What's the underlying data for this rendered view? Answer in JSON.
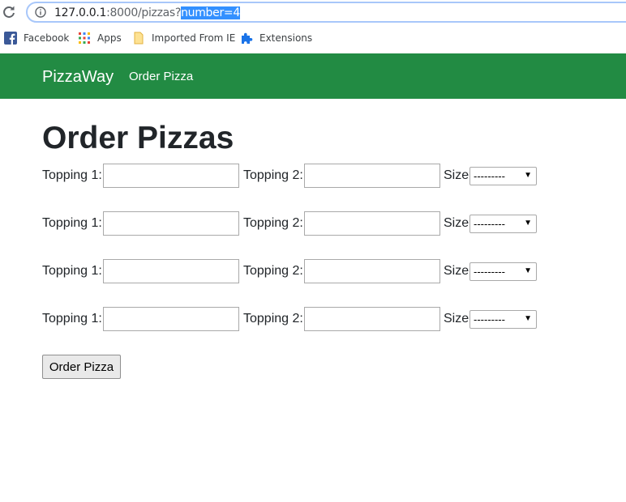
{
  "browser": {
    "url_host": "127.0.0.1",
    "url_path": ":8000/pizzas?",
    "url_selected": "number=4",
    "bookmarks": [
      {
        "label": "Facebook",
        "icon": "facebook-icon"
      },
      {
        "label": "Apps",
        "icon": "apps-grid-icon"
      },
      {
        "label": "Imported From IE",
        "icon": "folder-icon"
      },
      {
        "label": "Extensions",
        "icon": "puzzle-icon"
      }
    ]
  },
  "navbar": {
    "brand": "PizzaWay",
    "link": "Order Pizza",
    "color": "#228b43"
  },
  "main": {
    "title": "Order Pizzas",
    "rows": [
      {
        "topping1_label": "Topping 1:",
        "topping1_value": "",
        "topping2_label": "Topping 2:",
        "topping2_value": "",
        "size_label": "Size:",
        "size_value": "---------"
      },
      {
        "topping1_label": "Topping 1:",
        "topping1_value": "",
        "topping2_label": "Topping 2:",
        "topping2_value": "",
        "size_label": "Size:",
        "size_value": "---------"
      },
      {
        "topping1_label": "Topping 1:",
        "topping1_value": "",
        "topping2_label": "Topping 2:",
        "topping2_value": "",
        "size_label": "Size:",
        "size_value": "---------"
      },
      {
        "topping1_label": "Topping 1:",
        "topping1_value": "",
        "topping2_label": "Topping 2:",
        "topping2_value": "",
        "size_label": "Size:",
        "size_value": "---------"
      }
    ],
    "submit_label": "Order Pizza"
  }
}
